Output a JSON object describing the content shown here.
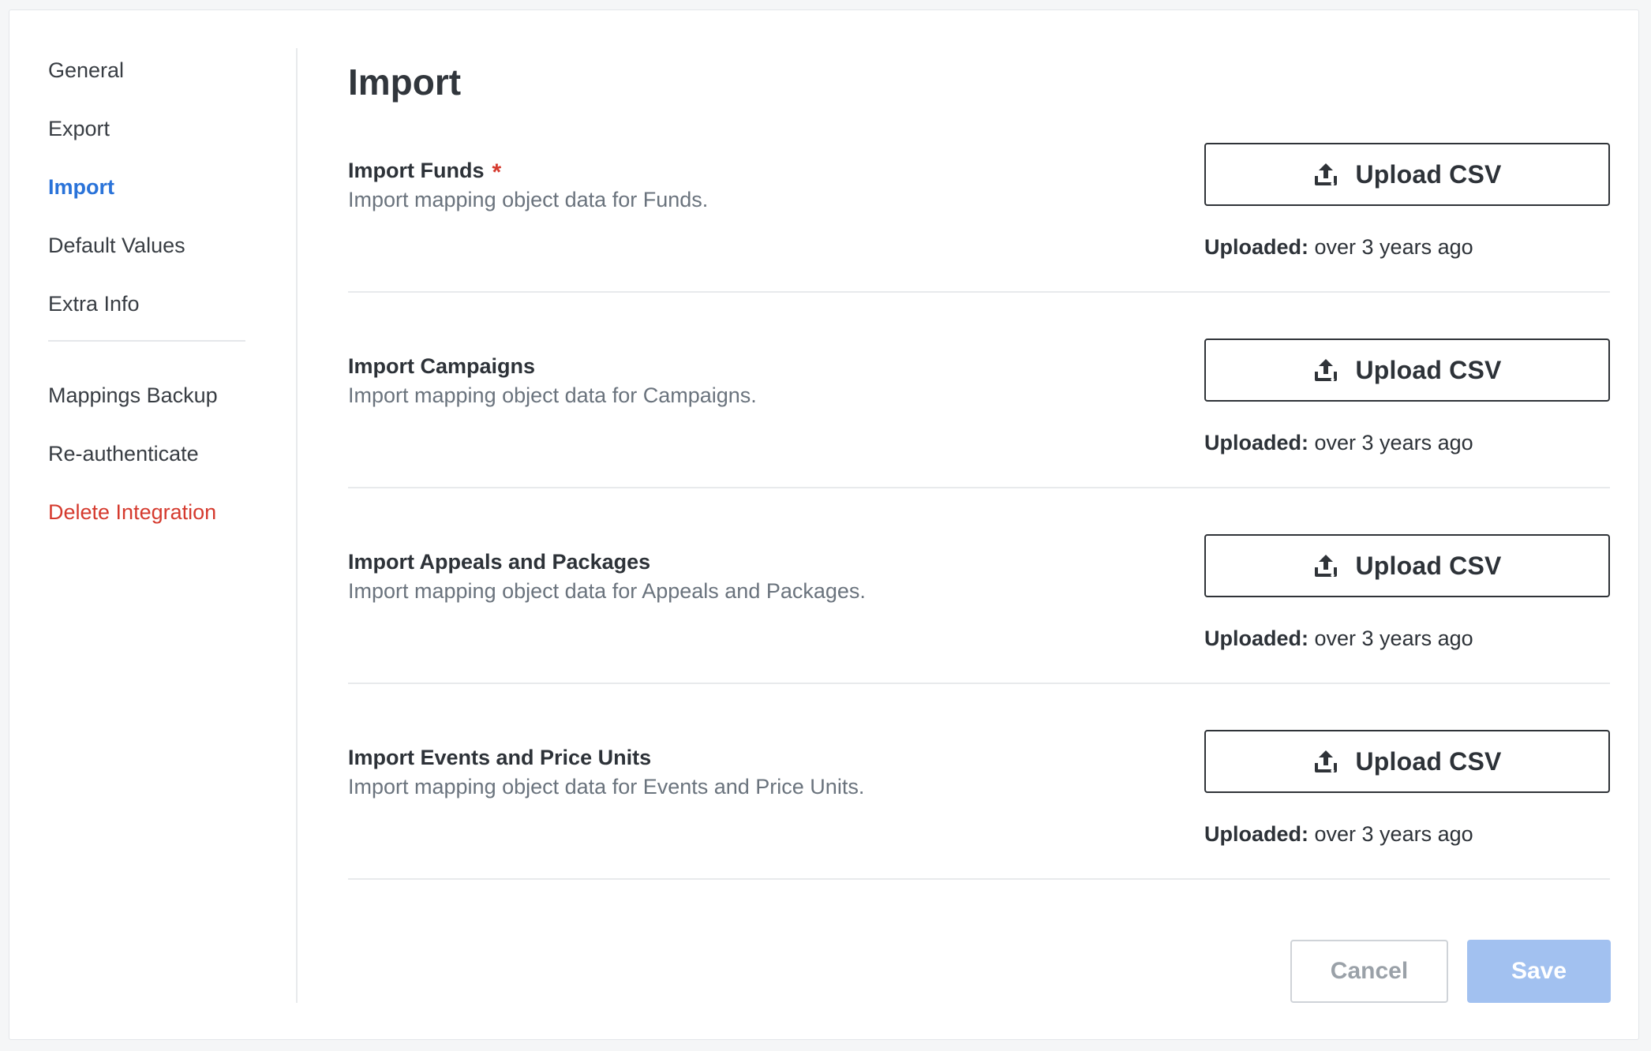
{
  "sidebar": {
    "items": [
      {
        "label": "General"
      },
      {
        "label": "Export"
      },
      {
        "label": "Import"
      },
      {
        "label": "Default Values"
      },
      {
        "label": "Extra Info"
      },
      {
        "label": "Mappings Backup"
      },
      {
        "label": "Re-authenticate"
      },
      {
        "label": "Delete Integration"
      }
    ]
  },
  "main": {
    "title": "Import",
    "sections": [
      {
        "title": "Import Funds",
        "required_mark": "*",
        "description": "Import mapping object data for Funds.",
        "button_label": "Upload CSV",
        "uploaded_label": "Uploaded:",
        "uploaded_value": "over 3 years ago"
      },
      {
        "title": "Import Campaigns",
        "description": "Import mapping object data for Campaigns.",
        "button_label": "Upload CSV",
        "uploaded_label": "Uploaded:",
        "uploaded_value": "over 3 years ago"
      },
      {
        "title": "Import Appeals and Packages",
        "description": "Import mapping object data for Appeals and Packages.",
        "button_label": "Upload CSV",
        "uploaded_label": "Uploaded:",
        "uploaded_value": "over 3 years ago"
      },
      {
        "title": "Import Events and Price Units",
        "description": "Import mapping object data for Events and Price Units.",
        "button_label": "Upload CSV",
        "uploaded_label": "Uploaded:",
        "uploaded_value": "over 3 years ago"
      }
    ],
    "icon": "upload-icon"
  },
  "footer": {
    "cancel_label": "Cancel",
    "save_label": "Save"
  },
  "colors": {
    "accent": "#2a73d9",
    "danger": "#d53a2e",
    "save_disabled": "#a2c1f0"
  }
}
